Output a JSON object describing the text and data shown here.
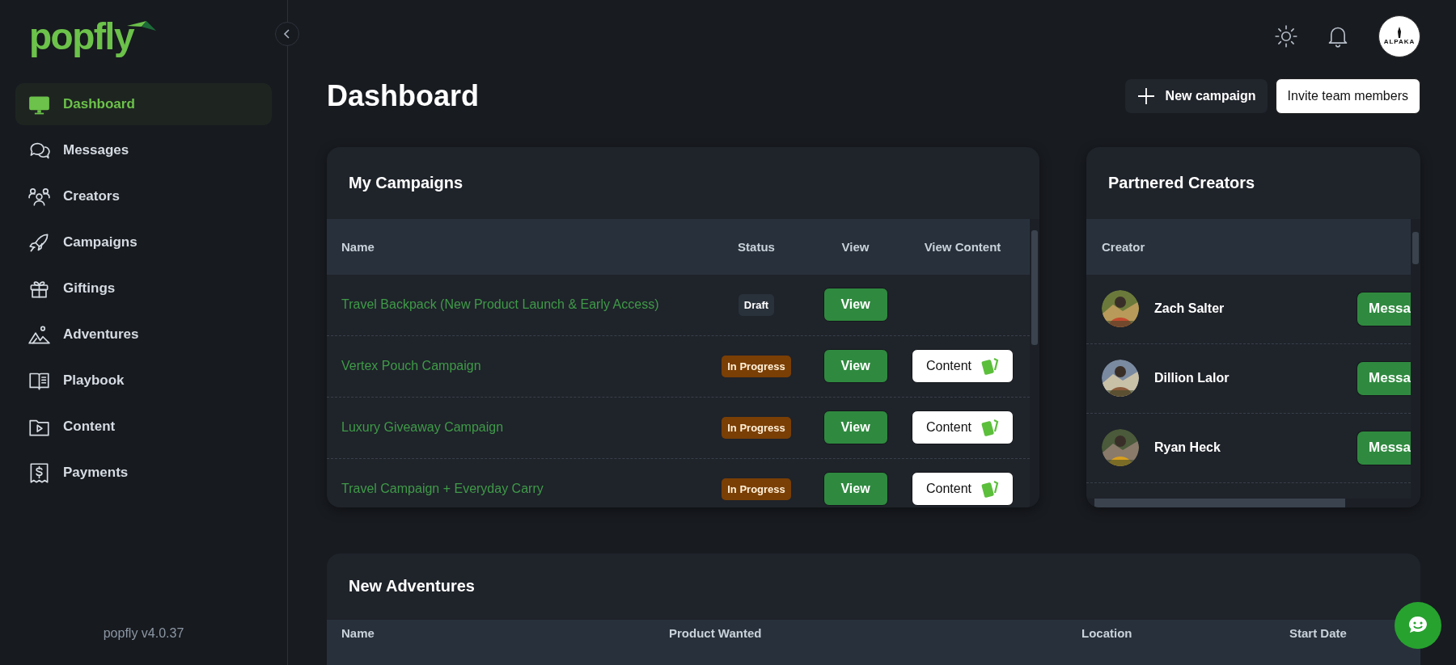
{
  "sidebar": {
    "logo": "popfly",
    "items": [
      {
        "label": "Dashboard",
        "selected": true
      },
      {
        "label": "Messages",
        "selected": false
      },
      {
        "label": "Creators",
        "selected": false
      },
      {
        "label": "Campaigns",
        "selected": false
      },
      {
        "label": "Giftings",
        "selected": false
      },
      {
        "label": "Adventures",
        "selected": false
      },
      {
        "label": "Playbook",
        "selected": false
      },
      {
        "label": "Content",
        "selected": false
      },
      {
        "label": "Payments",
        "selected": false
      }
    ],
    "version": "popfly v4.0.37"
  },
  "header": {
    "avatar_text": "ALPAKA",
    "title": "Dashboard",
    "new_campaign": "New campaign",
    "invite": "Invite team members"
  },
  "campaigns": {
    "title": "My Campaigns",
    "columns": [
      "Name",
      "Status",
      "View",
      "View Content"
    ],
    "rows": [
      {
        "name": "Travel Backpack (New Product Launch & Early Access)",
        "status": "Draft",
        "kind": "draft",
        "view": "View"
      },
      {
        "name": "Vertex Pouch Campaign",
        "status": "In Progress",
        "kind": "in_progress",
        "view": "View",
        "content": "Content"
      },
      {
        "name": "Luxury Giveaway Campaign",
        "status": "In Progress",
        "kind": "in_progress",
        "view": "View",
        "content": "Content"
      },
      {
        "name": "Travel Campaign + Everyday Carry",
        "status": "In Progress",
        "kind": "in_progress",
        "view": "View",
        "content": "Content"
      }
    ]
  },
  "creators": {
    "title": "Partnered Creators",
    "columns": [
      "Creator"
    ],
    "rows": [
      {
        "name": "Zach Salter",
        "action": "Messa"
      },
      {
        "name": "Dillion Lalor",
        "action": "Messa"
      },
      {
        "name": "Ryan Heck",
        "action": "Messa"
      }
    ]
  },
  "adventures": {
    "title": "New Adventures",
    "columns": [
      "Name",
      "Product Wanted",
      "Location",
      "Start Date"
    ]
  }
}
